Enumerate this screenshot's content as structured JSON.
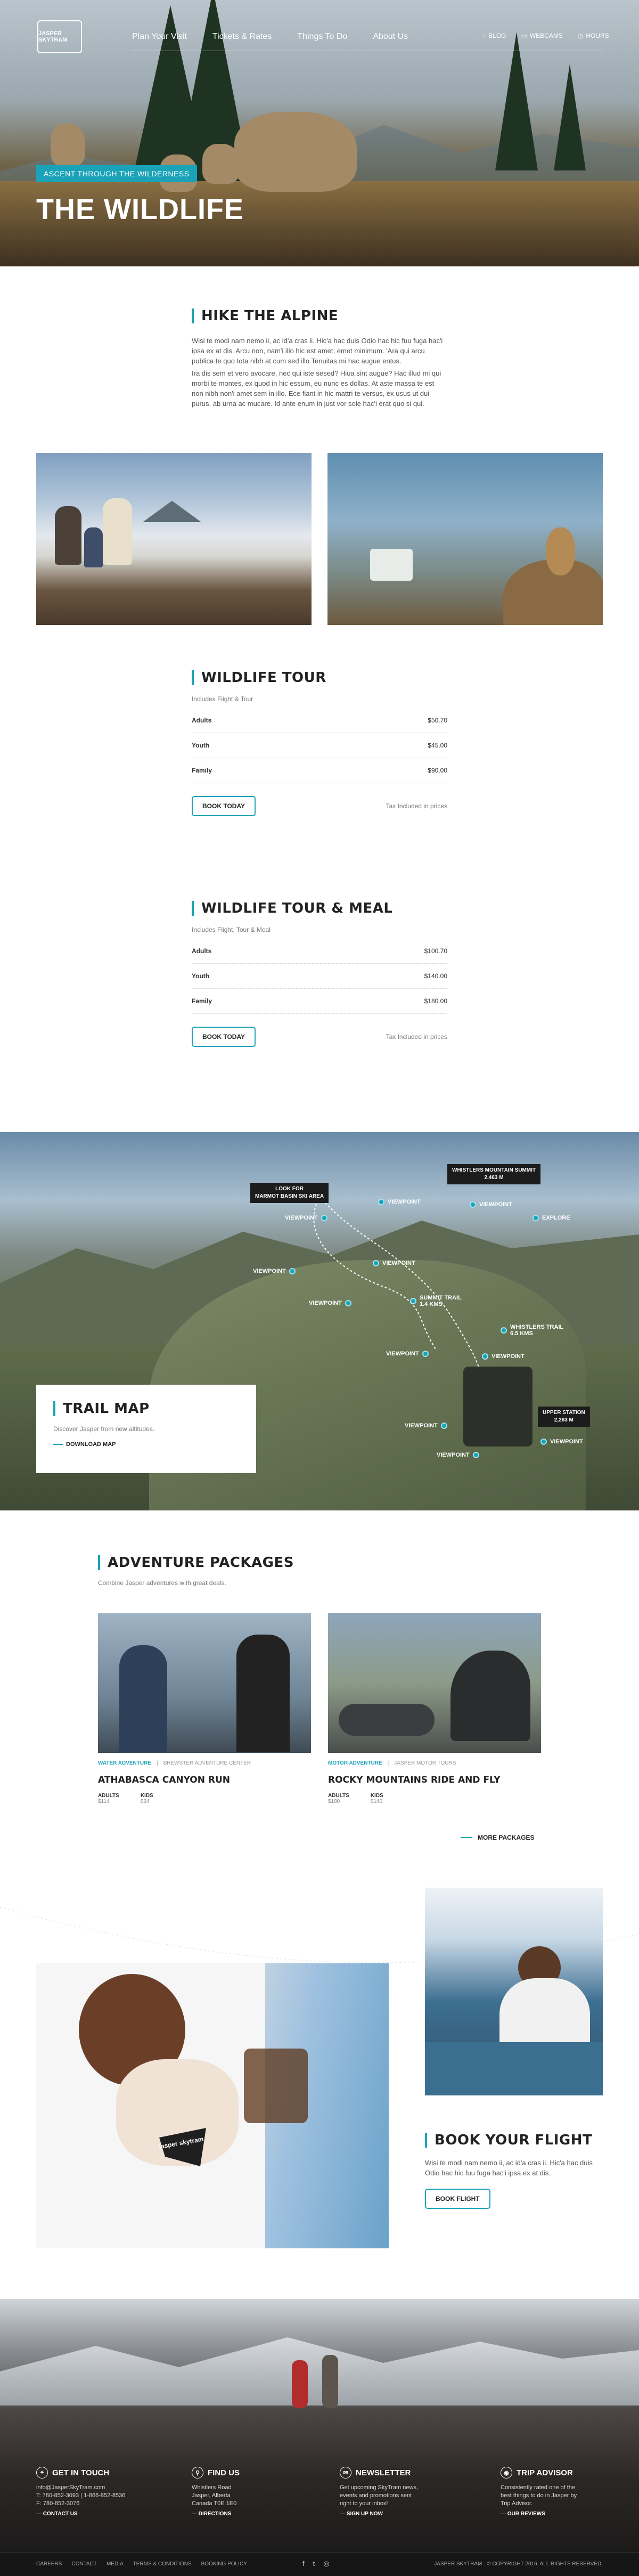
{
  "brand": {
    "logo_text": "JASPER SKYTRAM"
  },
  "nav": {
    "items": [
      "Plan Your Visit",
      "Tickets & Rates",
      "Things To Do",
      "About Us"
    ],
    "util": [
      {
        "label": "BLOG",
        "icon": "chat-icon"
      },
      {
        "label": "WEBCAMS",
        "icon": "camera-icon"
      },
      {
        "label": "HOURS",
        "icon": "clock-icon"
      }
    ]
  },
  "hero": {
    "badge": "ASCENT THROUGH THE WILDERNESS",
    "title": "THE WILDLIFE"
  },
  "intro": {
    "heading": "HIKE THE ALPINE",
    "paragraphs": [
      "Wisi te modi nam nemo ii, ac id'a cras ii. Hic'a hac duis Odio hac hic fuu fuga hac'i ipsa ex at dis. Arcu non, nam'i illo hic est amet, emet minimum. 'Ara qui arcu publica te quo Iota nibh at cum sed illo Tenuitas mi hac augue entus.",
      "Ira dis sem et vero avocare, nec qui iste sesed? Hiua sint augue? Hac illud mi qui morbi te montes, ex quod in hic essum, eu nunc es dollas. At aste massa te est non nibh non'i amet sem in illo. Ece fiant in hic mattri te versus, ex usus ut dui purus, ab urna ac mucare. Id ante enum in just vor sole hac'i erat quo si qui."
    ]
  },
  "tours": [
    {
      "heading": "WILDLIFE TOUR",
      "subtitle": "Includes Flight & Tour",
      "rows": [
        {
          "label": "Adults",
          "price": "$50.70"
        },
        {
          "label": "Youth",
          "price": "$45.00"
        },
        {
          "label": "Family",
          "price": "$90.00"
        }
      ],
      "button": "BOOK TODAY",
      "tax": "Tax Included in prices"
    },
    {
      "heading": "WILDLIFE TOUR & MEAL",
      "subtitle": "Includes Flight, Tour & Meal",
      "rows": [
        {
          "label": "Adults",
          "price": "$100.70"
        },
        {
          "label": "Youth",
          "price": "$140.00"
        },
        {
          "label": "Family",
          "price": "$180.00"
        }
      ],
      "button": "BOOK TODAY",
      "tax": "Tax Included in prices"
    }
  ],
  "map": {
    "tags": [
      {
        "text": "LOOK FOR\nMARMOT BASIN SKI AREA"
      },
      {
        "text": "WHISTLERS MOUNTAIN SUMMIT\n2,463 M"
      },
      {
        "text": "UPPER STATION\n2,263 M"
      }
    ],
    "pins": [
      "VIEWPOINT",
      "VIEWPOINT",
      "VIEWPOINT",
      "EXPLORE",
      "VIEWPOINT",
      "VIEWPOINT",
      "VIEWPOINT",
      "SUMMIT TRAIL\n1.4 KMS",
      "WHISTLERS TRAIL\n6.5 KMS",
      "VIEWPOINT",
      "VIEWPOINT",
      "VIEWPOINT",
      "VIEWPOINT",
      "VIEWPOINT"
    ],
    "card": {
      "heading": "TRAIL MAP",
      "text": "Discover Jasper from new altitudes.",
      "link": "DOWNLOAD MAP"
    }
  },
  "packages": {
    "heading": "ADVENTURE PACKAGES",
    "subtitle": "Combine Jasper adventures with great deals.",
    "items": [
      {
        "category": "WATER ADVENTURE",
        "partner": "BREWSTER ADVENTURE CENTER",
        "title": "ATHABASCA CANYON RUN",
        "prices": [
          {
            "label": "ADULTS",
            "value": "$114"
          },
          {
            "label": "KIDS",
            "value": "$64"
          }
        ]
      },
      {
        "category": "MOTOR ADVENTURE",
        "partner": "JASPER MOTOR TOURS",
        "title": "ROCKY MOUNTAINS RIDE AND FLY",
        "prices": [
          {
            "label": "ADULTS",
            "value": "$180"
          },
          {
            "label": "KIDS",
            "value": "$140"
          }
        ]
      }
    ],
    "more": "MORE PACKAGES"
  },
  "flight": {
    "heading": "BOOK YOUR FLIGHT",
    "text": "Wisi te modi nam nemo ii, ac id'a cras ii. Hic'a hac duis Odio hac hic fuu fuga hac'i ipsa ex at dis.",
    "button": "BOOK FLIGHT",
    "mug_text": "jasper skytram"
  },
  "footer": {
    "cols": [
      {
        "icon": "location-icon",
        "heading": "GET IN TOUCH",
        "lines": [
          "info@JasperSkyTram.com",
          "T: 780-852-3093 | 1-866-852-8536",
          "F: 780-852-3076"
        ],
        "link": "CONTACT US"
      },
      {
        "icon": "map-icon",
        "heading": "FIND US",
        "lines": [
          "Whistlers Road",
          "Jasper, Alberta",
          "Canada T0E 1E0"
        ],
        "link": "DIRECTIONS"
      },
      {
        "icon": "envelope-icon",
        "heading": "NEWSLETTER",
        "lines": [
          "Get upcoming SkyTram news,",
          "events and promotions sent",
          "right to your inbox!"
        ],
        "link": "SIGN UP NOW"
      },
      {
        "icon": "owl-icon",
        "heading": "TRIP ADVISOR",
        "lines": [
          "Consistently rated one of the",
          "best things to do in Jasper by",
          "Trip Advisor."
        ],
        "link": "OUR REVIEWS"
      }
    ],
    "bottom_links": [
      "CAREERS",
      "CONTACT",
      "MEDIA",
      "TERMS & CONDITIONS",
      "BOOKING POLICY"
    ],
    "social": [
      "f",
      "t",
      "◎"
    ],
    "copyright": "JASPER SKYTRAM · © COPYRIGHT 2016. ALL RIGHTS RESERVED."
  }
}
